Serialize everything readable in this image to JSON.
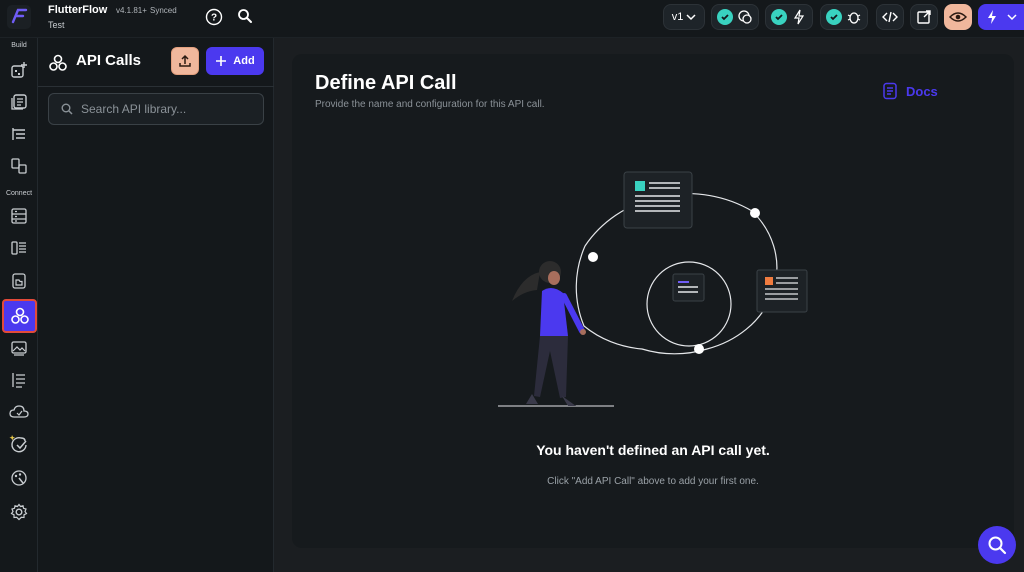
{
  "app": {
    "brand": "FlutterFlow",
    "version": "v4.1.81+",
    "sync_status": "Synced",
    "project": "Test"
  },
  "topbar": {
    "version_select": "v1",
    "status_buttons": [
      "chat-icon",
      "lightning-icon",
      "bug-icon"
    ],
    "icons": [
      "help-icon",
      "search-icon",
      "code-icon",
      "open-external-icon",
      "eye-icon",
      "lightning-icon"
    ]
  },
  "rail": {
    "build_label": "Build",
    "connect_label": "Connect",
    "items": [
      "add-widget-icon",
      "pages-icon",
      "list-icon",
      "components-icon",
      "database-icon",
      "firestore-icon",
      "storage-icon",
      "api-calls-icon",
      "media-assets-icon",
      "agents-icon",
      "cloud-functions-icon",
      "tests-icon",
      "theme-icon",
      "settings-icon"
    ]
  },
  "panel": {
    "title": "API Calls",
    "add_label": "Add",
    "search_placeholder": "Search API library..."
  },
  "main": {
    "title": "Define API Call",
    "subtitle": "Provide the name and configuration for this API call.",
    "docs_label": "Docs",
    "empty_title": "You haven't defined an API call yet.",
    "empty_subtitle": "Click \"Add API Call\" above to add your first one."
  },
  "colors": {
    "accent": "#4b39ef",
    "success": "#39d2c0",
    "peach": "#f0b79c",
    "highlight_border": "#e24a3a"
  }
}
